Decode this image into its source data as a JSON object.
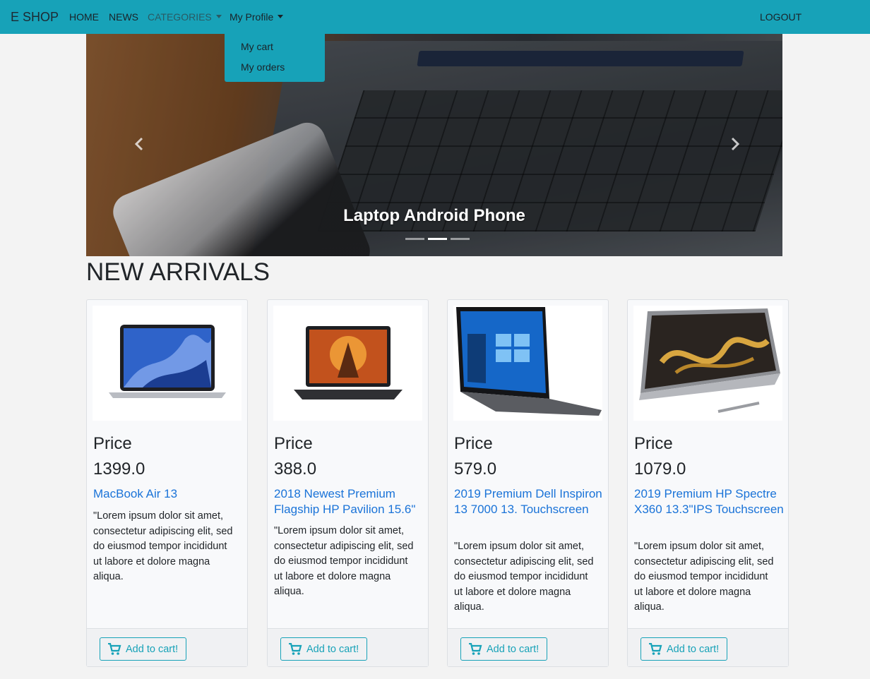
{
  "navbar": {
    "brand": "E SHOP",
    "links": [
      "HOME",
      "NEWS",
      "CATEGORIES",
      "My Profile"
    ],
    "logout": "LOGOUT",
    "bg_color": "#17a2b8"
  },
  "profile_dropdown": {
    "items": [
      "My cart",
      "My orders"
    ]
  },
  "carousel": {
    "caption": "Laptop Android Phone",
    "prev_icon": "chevron-left-icon",
    "next_icon": "chevron-right-icon",
    "slide_count": 3,
    "active_slide": 2
  },
  "section_title": "NEW ARRIVALS",
  "products": [
    {
      "price_label": "Price",
      "price": "1399.0",
      "name": "MacBook Air 13",
      "description": "\"Lorem ipsum dolor sit amet, consectetur adipiscing elit, sed do eiusmod tempor incididunt ut labore et dolore magna aliqua.",
      "button": "Add to cart!"
    },
    {
      "price_label": "Price",
      "price": "388.0",
      "name": "2018 Newest Premium Flagship HP Pavilion 15.6\"",
      "description": "\"Lorem ipsum dolor sit amet, consectetur adipiscing elit, sed do eiusmod tempor incididunt ut labore et dolore magna aliqua.",
      "button": "Add to cart!"
    },
    {
      "price_label": "Price",
      "price": "579.0",
      "name": "2019 Premium Dell Inspiron 13 7000 13. Touchscreen",
      "description": "\"Lorem ipsum dolor sit amet, consectetur adipiscing elit, sed do eiusmod tempor incididunt ut labore et dolore magna aliqua.",
      "button": "Add to cart!"
    },
    {
      "price_label": "Price",
      "price": "1079.0",
      "name": "2019 Premium HP Spectre X360 13.3\"IPS Touchscreen",
      "description": "\"Lorem ipsum dolor sit amet, consectetur adipiscing elit, sed do eiusmod tempor incididunt ut labore et dolore magna aliqua.",
      "button": "Add to cart!"
    }
  ],
  "colors": {
    "accent": "#17a2b8",
    "link": "#1a73d8"
  }
}
